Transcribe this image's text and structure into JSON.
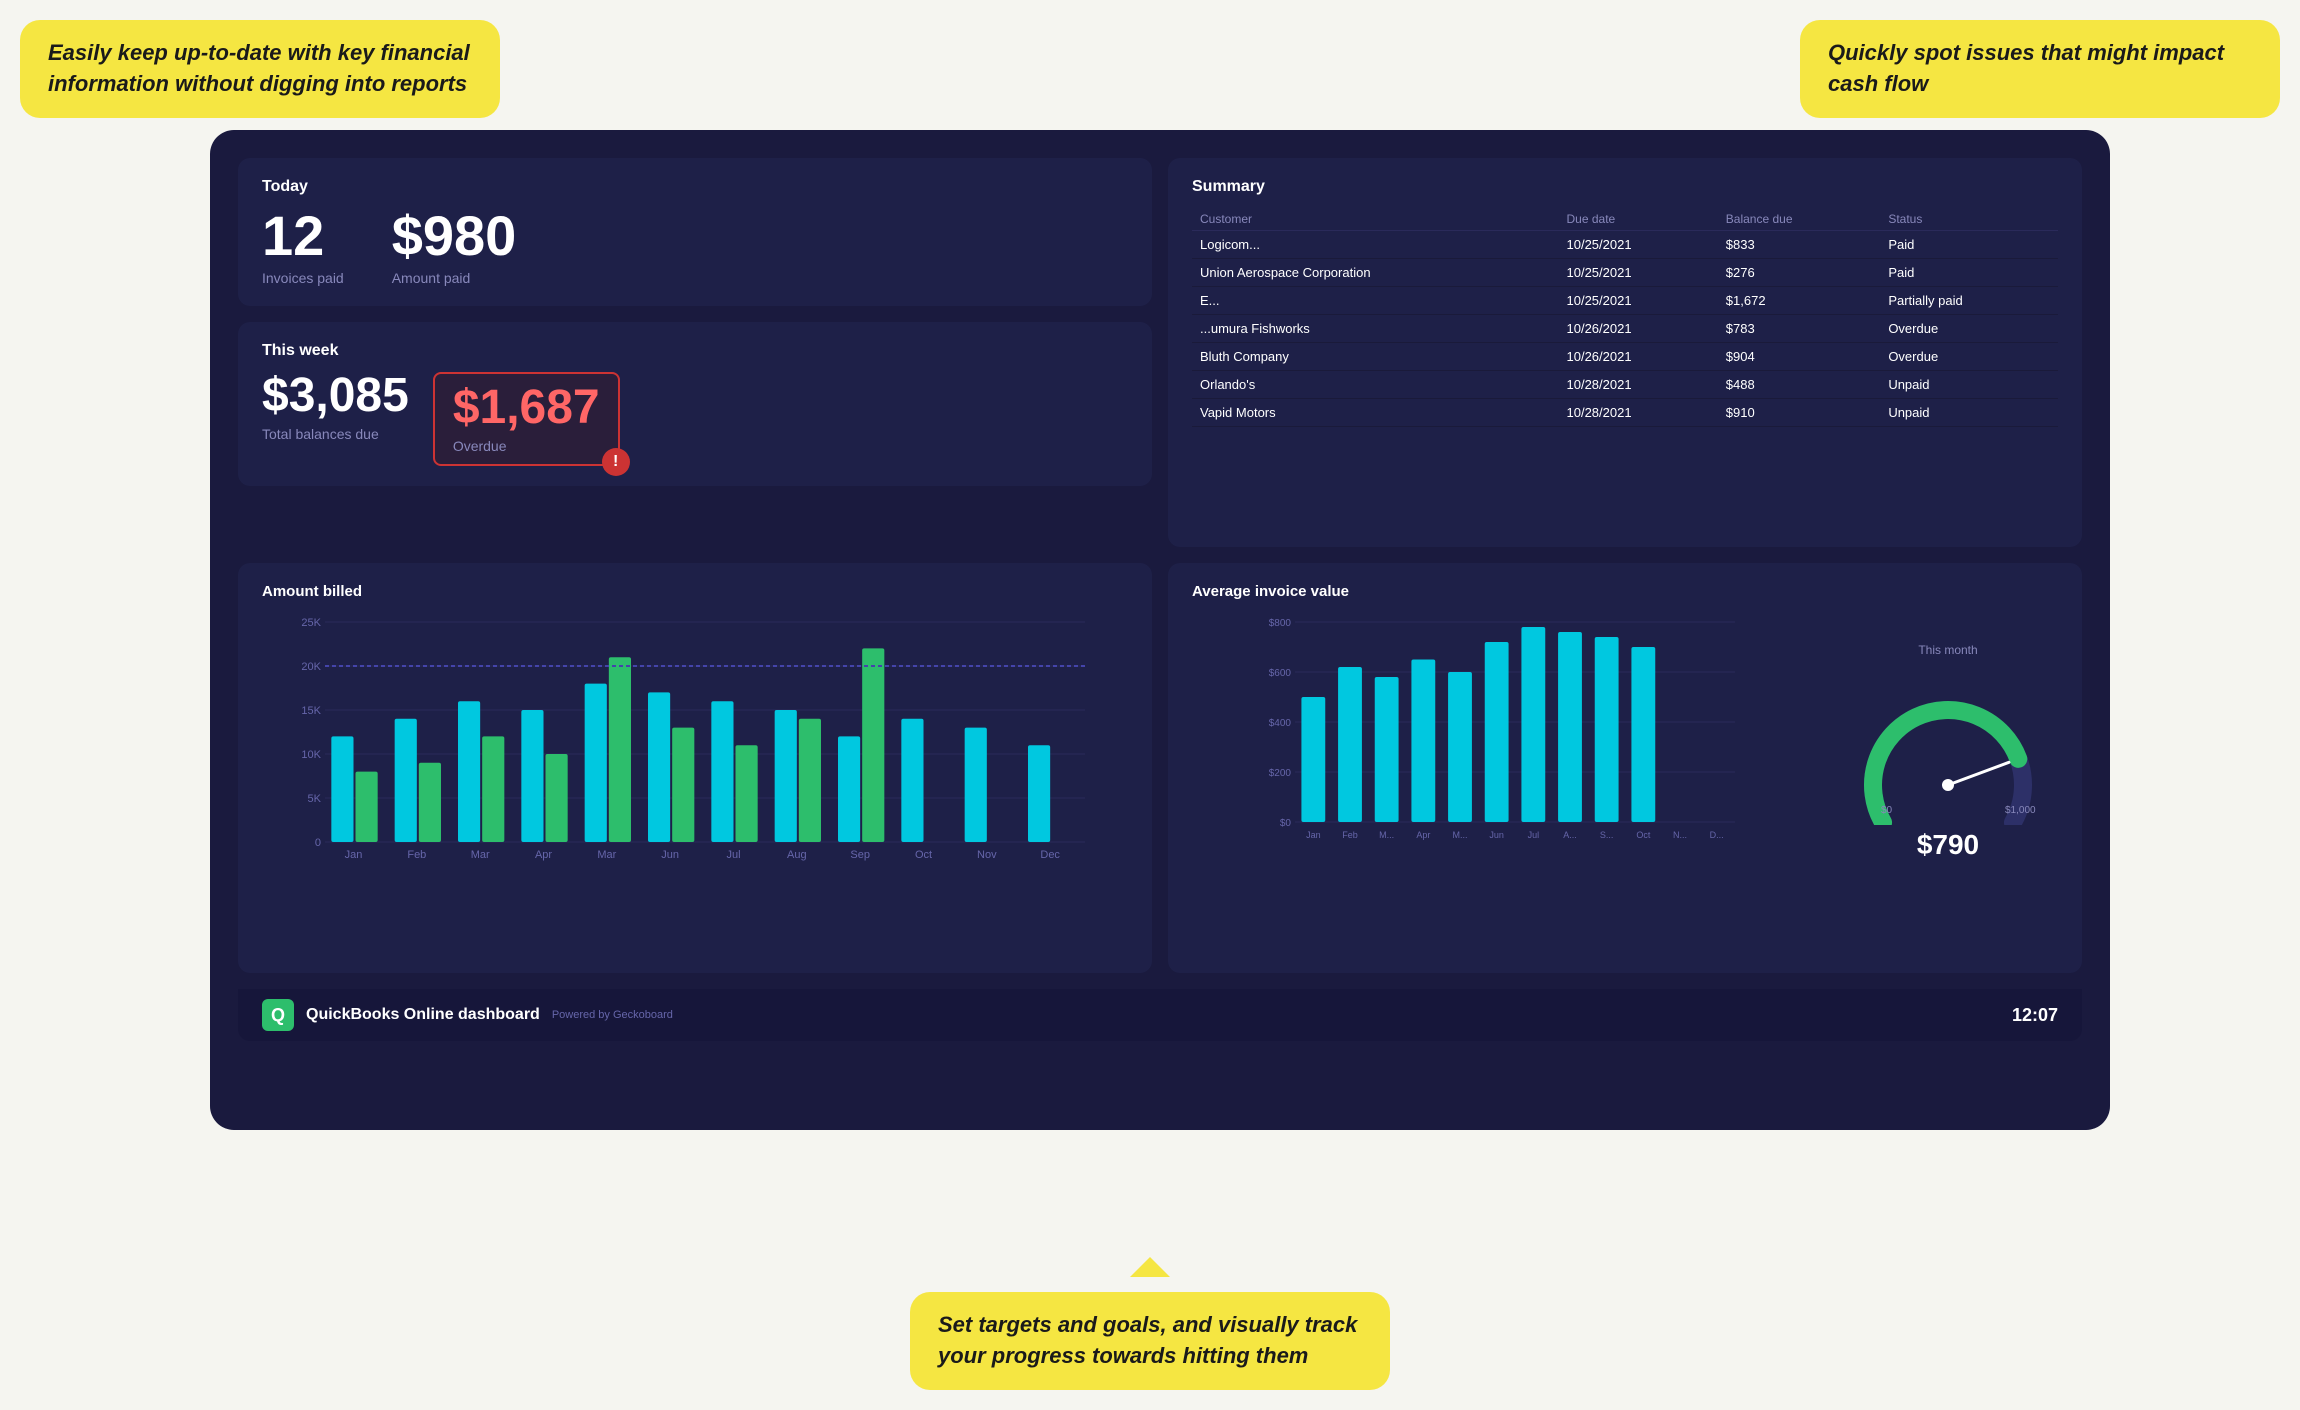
{
  "callouts": {
    "top_left": "Easily keep up-to-date with key financial information without digging into reports",
    "top_right": "Quickly spot issues that might impact cash flow",
    "bottom": "Set targets and goals, and visually track your progress towards hitting them"
  },
  "today": {
    "title": "Today",
    "invoices_count": "12",
    "invoices_label": "Invoices paid",
    "amount": "$980",
    "amount_label": "Amount paid"
  },
  "this_week": {
    "title": "This week",
    "total_label": "Total balances due",
    "total_value": "$3,085",
    "overdue_value": "$1,687",
    "overdue_label": "Overdue"
  },
  "summary": {
    "title": "Summary",
    "columns": [
      "Customer",
      "Due date",
      "Balance due",
      "Status"
    ],
    "rows": [
      {
        "customer": "Logicom...",
        "due_date": "10/25/2021",
        "balance": "$833",
        "status": "Paid",
        "status_class": "paid"
      },
      {
        "customer": "Union Aerospace Corporation",
        "due_date": "10/25/2021",
        "balance": "$276",
        "status": "Paid",
        "status_class": "paid"
      },
      {
        "customer": "E...",
        "due_date": "10/25/2021",
        "balance": "$1,672",
        "status": "Partially paid",
        "status_class": "partial"
      },
      {
        "customer": "...umura Fishworks",
        "due_date": "10/26/2021",
        "balance": "$783",
        "status": "Overdue",
        "status_class": "overdue"
      },
      {
        "customer": "Bluth Company",
        "due_date": "10/26/2021",
        "balance": "$904",
        "status": "Overdue",
        "status_class": "overdue"
      },
      {
        "customer": "Orlando's",
        "due_date": "10/28/2021",
        "balance": "$488",
        "status": "Unpaid",
        "status_class": "unpaid"
      },
      {
        "customer": "Vapid Motors",
        "due_date": "10/28/2021",
        "balance": "$910",
        "status": "Unpaid",
        "status_class": "unpaid"
      }
    ]
  },
  "amount_billed": {
    "title": "Amount billed",
    "y_labels": [
      "25K",
      "20K",
      "15K",
      "10K",
      "5K",
      "0"
    ],
    "x_labels": [
      "Jan",
      "Feb",
      "Mar",
      "Apr",
      "Mar",
      "Jun",
      "Jul",
      "Aug",
      "Sep",
      "Oct",
      "Nov",
      "Dec"
    ],
    "bars": [
      {
        "month": "Jan",
        "cyan": 12000,
        "green": 8000
      },
      {
        "month": "Feb",
        "cyan": 14000,
        "green": 9000
      },
      {
        "month": "Mar",
        "cyan": 16000,
        "green": 12000
      },
      {
        "month": "Apr",
        "cyan": 15000,
        "green": 10000
      },
      {
        "month": "Mar",
        "cyan": 18000,
        "green": 21000
      },
      {
        "month": "Jun",
        "cyan": 17000,
        "green": 13000
      },
      {
        "month": "Jul",
        "cyan": 16000,
        "green": 11000
      },
      {
        "month": "Aug",
        "cyan": 15000,
        "green": 14000
      },
      {
        "month": "Sep",
        "cyan": 12000,
        "green": 22000
      },
      {
        "month": "Oct",
        "cyan": 14000,
        "green": 0
      },
      {
        "month": "Nov",
        "cyan": 13000,
        "green": 0
      },
      {
        "month": "Dec",
        "cyan": 11000,
        "green": 0
      }
    ],
    "max": 25000
  },
  "avg_invoice": {
    "title": "Average invoice value",
    "y_labels": [
      "$800",
      "$600",
      "$400",
      "$200",
      "$0"
    ],
    "x_labels": [
      "Jan",
      "Feb",
      "M...",
      "Apr",
      "M...",
      "Jun",
      "Jul",
      "A...",
      "S...",
      "Oct",
      "N...",
      "D..."
    ],
    "bars": [
      500,
      620,
      580,
      650,
      600,
      720,
      780,
      760,
      740,
      700,
      0,
      0
    ],
    "max": 800,
    "gauge": {
      "label": "This month",
      "value": "$790",
      "min": "$0",
      "max": "$1,000",
      "current": 790,
      "scale_max": 1000
    }
  },
  "footer": {
    "logo_text": "Q",
    "title": "QuickBooks Online dashboard",
    "powered": "Powered by Geckoboard",
    "time": "12:07"
  }
}
